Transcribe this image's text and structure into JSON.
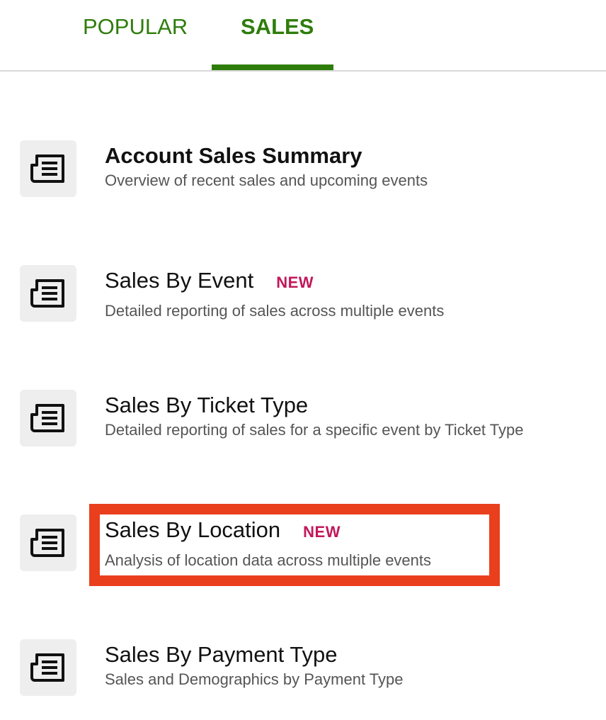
{
  "tabs": [
    {
      "label": "POPULAR",
      "active": false
    },
    {
      "label": "SALES",
      "active": true
    }
  ],
  "colors": {
    "accent": "#2e7d0b",
    "badge": "#c2185b",
    "highlight": "#ea3f1d"
  },
  "reports": [
    {
      "title": "Account Sales Summary",
      "description": "Overview of recent sales and upcoming events",
      "badge": "",
      "icon": "report-icon"
    },
    {
      "title": "Sales By Event",
      "description": "Detailed reporting of sales across multiple events",
      "badge": "NEW",
      "icon": "report-icon"
    },
    {
      "title": "Sales By Ticket Type",
      "description": "Detailed reporting of sales for a specific event by Ticket Type",
      "badge": "",
      "icon": "report-icon"
    },
    {
      "title": "Sales By Location",
      "description": "Analysis of location data across multiple events",
      "badge": "NEW",
      "icon": "report-icon",
      "highlighted": true
    },
    {
      "title": "Sales By Payment Type",
      "description": "Sales and Demographics by Payment Type",
      "badge": "",
      "icon": "report-icon"
    }
  ]
}
